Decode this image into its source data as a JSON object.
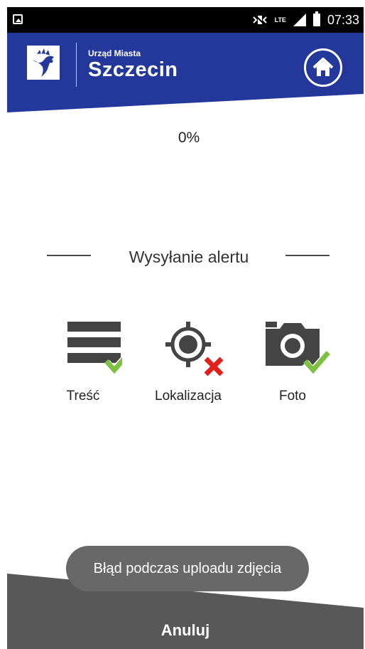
{
  "status_bar": {
    "time": "07:33",
    "network": "LTE"
  },
  "header": {
    "brand_small": "Urząd Miasta",
    "brand_city": "Szczecin",
    "color": "#24389b"
  },
  "progress": {
    "label": "0%",
    "value": 0
  },
  "section": {
    "title": "Wysyłanie alertu"
  },
  "steps": [
    {
      "label": "Treść",
      "icon": "list-icon",
      "status": "done"
    },
    {
      "label": "Lokalizacja",
      "icon": "location-crosshair-icon",
      "status": "error"
    },
    {
      "label": "Foto",
      "icon": "camera-icon",
      "status": "done"
    }
  ],
  "toast": {
    "message": "Błąd podczas uploadu zdjęcia"
  },
  "footer": {
    "cancel_label": "Anuluj",
    "color": "#585858"
  },
  "colors": {
    "check": "#7cc142",
    "error": "#e0201c",
    "icon": "#444444"
  }
}
